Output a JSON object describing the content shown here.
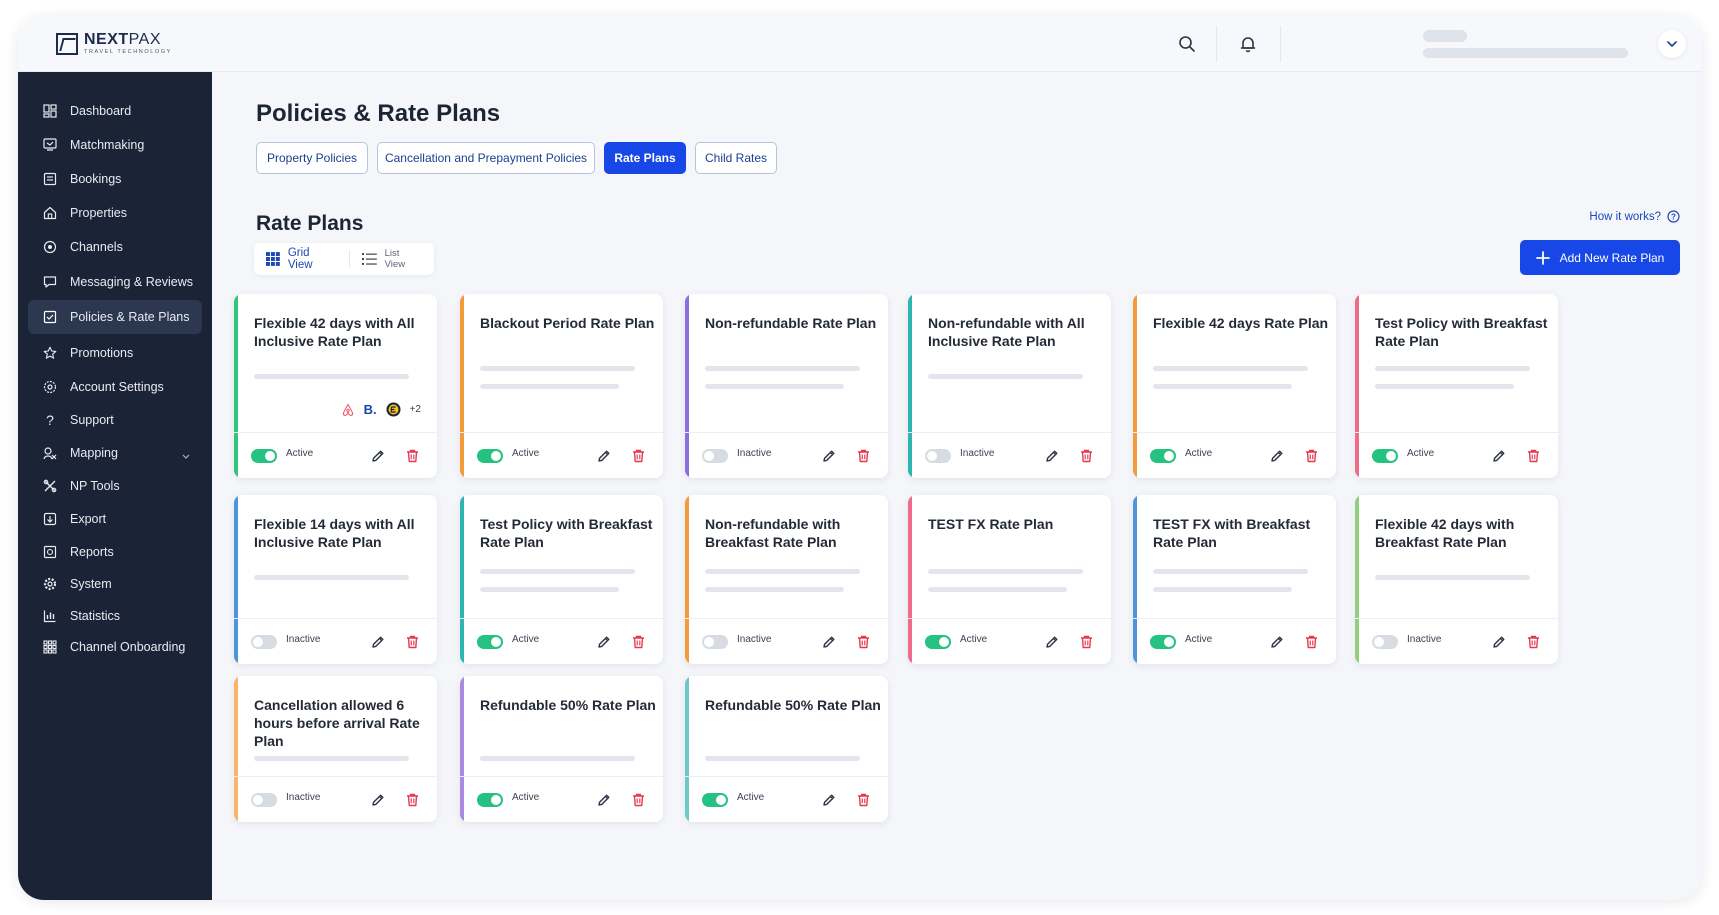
{
  "brand": {
    "name_bold": "NEXT",
    "name_light": "PAX",
    "tagline": "TRAVEL TECHNOLOGY"
  },
  "header": {
    "search_icon": "search-icon",
    "notification_icon": "bell-icon",
    "user_menu_icon": "chevron-down-icon"
  },
  "sidebar": {
    "items": [
      {
        "label": "Dashboard",
        "icon": "dashboard-icon"
      },
      {
        "label": "Matchmaking",
        "icon": "matchmaking-icon"
      },
      {
        "label": "Bookings",
        "icon": "bookings-icon"
      },
      {
        "label": "Properties",
        "icon": "home-icon"
      },
      {
        "label": "Channels",
        "icon": "channels-icon"
      },
      {
        "label": "Messaging & Reviews",
        "icon": "message-icon"
      },
      {
        "label": "Policies & Rate Plans",
        "icon": "policy-icon",
        "active": true
      },
      {
        "label": "Promotions",
        "icon": "star-icon"
      },
      {
        "label": "Account Settings",
        "icon": "account-settings-icon"
      },
      {
        "label": "Support",
        "icon": "question-icon"
      },
      {
        "label": "Mapping",
        "icon": "mapping-icon",
        "expandable": true
      },
      {
        "label": "NP Tools",
        "icon": "tools-icon"
      },
      {
        "label": "Export",
        "icon": "export-icon"
      },
      {
        "label": "Reports",
        "icon": "reports-icon"
      },
      {
        "label": "System",
        "icon": "gear-icon"
      },
      {
        "label": "Statistics",
        "icon": "statistics-icon"
      },
      {
        "label": "Channel Onboarding",
        "icon": "grid-icon"
      }
    ]
  },
  "page": {
    "title": "Policies & Rate Plans",
    "tabs": [
      {
        "label": "Property Policies",
        "active": false
      },
      {
        "label": "Cancellation and Prepayment Policies",
        "active": false
      },
      {
        "label": "Rate Plans",
        "active": true
      },
      {
        "label": "Child Rates",
        "active": false
      }
    ],
    "section_title": "Rate Plans",
    "how_it_works": "How it works?",
    "grid_view_label": "Grid View",
    "list_view_label": "List View",
    "add_button_label": "Add New Rate Plan"
  },
  "status_labels": {
    "active": "Active",
    "inactive": "Inactive"
  },
  "colors": {
    "primary": "#1747e6",
    "sidebar_bg": "#1b2336",
    "toggle_on": "#26c281",
    "delete": "#e53950",
    "accent_green": "#34c47c",
    "accent_orange": "#f39a3c",
    "accent_purple": "#8b6ee0",
    "accent_teal": "#2fb5b0",
    "accent_pink": "#ef6b8a",
    "accent_blue": "#4f93d8",
    "accent_light_green": "#8fd07f",
    "accent_light_orange": "#f7b56b",
    "accent_lavender": "#a78be3",
    "accent_light_teal": "#6fc8c6"
  },
  "rate_plans": [
    {
      "title": "Flexible 42 days with All Inclusive Rate Plan",
      "accent": "#34c47c",
      "active": true,
      "channels": [
        "airbnb-icon",
        "B.",
        "expedia-icon"
      ],
      "channels_more": "+2"
    },
    {
      "title": "Blackout Period Rate Plan",
      "accent": "#f39a3c",
      "active": true
    },
    {
      "title": "Non-refundable Rate Plan",
      "accent": "#8b6ee0",
      "active": false
    },
    {
      "title": "Non-refundable with All Inclusive Rate Plan",
      "accent": "#2fb5b0",
      "active": false
    },
    {
      "title": "Flexible 42 days Rate Plan",
      "accent": "#f39a3c",
      "active": true
    },
    {
      "title": "Test Policy with Breakfast Rate Plan",
      "accent": "#ef6b8a",
      "active": true
    },
    {
      "title": "Flexible 14 days with All Inclusive Rate Plan",
      "accent": "#4f93d8",
      "active": false
    },
    {
      "title": "Test Policy with Breakfast Rate Plan",
      "accent": "#2fb5b0",
      "active": true
    },
    {
      "title": "Non-refundable with Breakfast Rate Plan",
      "accent": "#f39a3c",
      "active": false
    },
    {
      "title": "TEST FX Rate Plan",
      "accent": "#ef6b8a",
      "active": true
    },
    {
      "title": "TEST FX with Breakfast Rate Plan",
      "accent": "#4f93d8",
      "active": true
    },
    {
      "title": "Flexible 42 days with Breakfast Rate Plan",
      "accent": "#8fd07f",
      "active": false
    },
    {
      "title": "Cancellation allowed 6 hours before arrival Rate Plan",
      "accent": "#f7b56b",
      "active": false
    },
    {
      "title": "Refundable 50% Rate Plan",
      "accent": "#a78be3",
      "active": true
    },
    {
      "title": "Refundable 50% Rate Plan",
      "accent": "#6fc8c6",
      "active": true
    }
  ]
}
